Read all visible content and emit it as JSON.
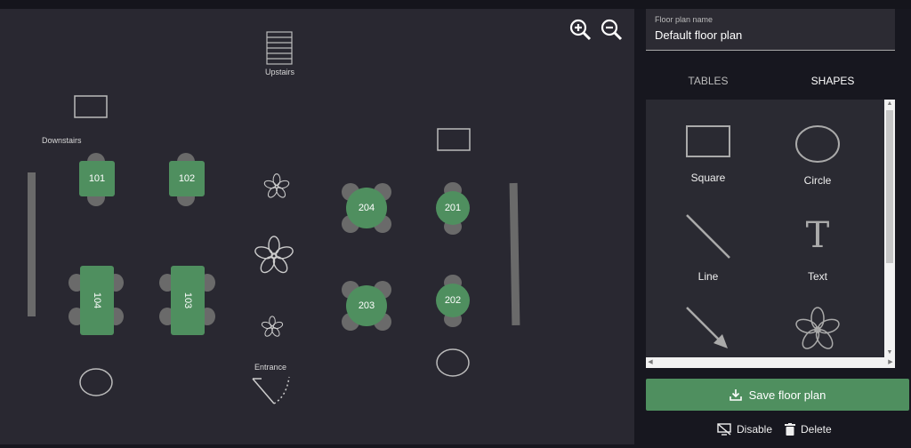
{
  "floor_plan": {
    "labels": {
      "downstairs": "Downstairs",
      "upstairs": "Upstairs",
      "entrance": "Entrance"
    },
    "tables": [
      "101",
      "102",
      "104",
      "103",
      "204",
      "201",
      "203",
      "202"
    ]
  },
  "zoom": {
    "in_icon": "zoom-in-icon",
    "out_icon": "zoom-out-icon"
  },
  "panel": {
    "name_field": {
      "label": "Floor plan name",
      "value": "Default floor plan"
    },
    "tabs": [
      {
        "label": "TABLES",
        "active": false
      },
      {
        "label": "SHAPES",
        "active": true
      }
    ],
    "shapes": [
      "Square",
      "Circle",
      "Line",
      "Text"
    ],
    "save_label": "Save floor plan",
    "disable_label": "Disable",
    "delete_label": "Delete"
  },
  "colors": {
    "accent": "#4f8f5f",
    "canvas": "#292831",
    "background": "#17171f"
  }
}
